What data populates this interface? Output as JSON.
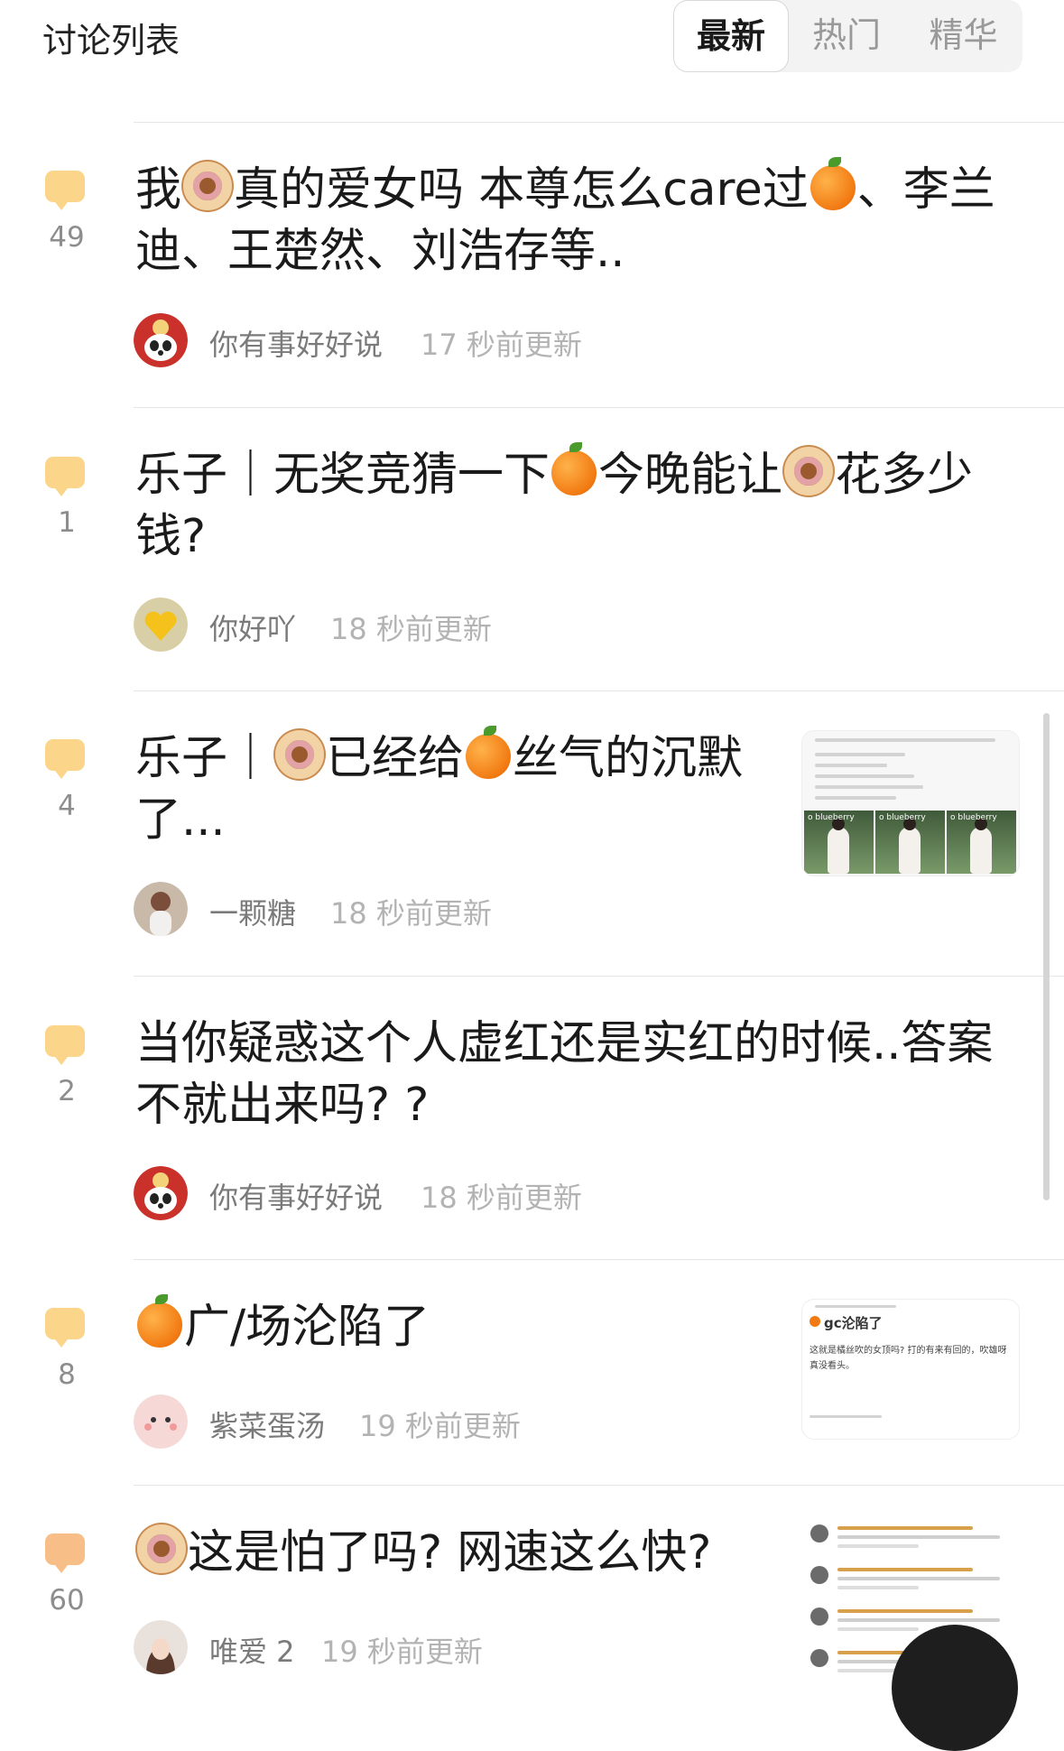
{
  "header": {
    "title": "讨论列表",
    "tabs": [
      {
        "label": "最新",
        "active": true
      },
      {
        "label": "热门",
        "active": false
      },
      {
        "label": "精华",
        "active": false
      }
    ]
  },
  "posts": [
    {
      "comment_count": "49",
      "title_parts": [
        "我",
        "真的爱女吗 本尊怎么care过",
        "、李兰迪、王楚然、刘浩存等.."
      ],
      "author": "你有事好好说",
      "time": "17 秒前更新"
    },
    {
      "comment_count": "1",
      "title_parts": [
        "乐子｜无奖竞猜一下",
        "今晚能让",
        "花多少钱?"
      ],
      "author": "你好吖",
      "time": "18 秒前更新"
    },
    {
      "comment_count": "4",
      "title_parts": [
        "乐子｜",
        "已经给",
        "丝气的沉默了..."
      ],
      "author": "一颗糖",
      "time": "18 秒前更新",
      "thumbnail": {
        "labels": [
          "o blueberry",
          "o blueberry",
          "o blueberry"
        ]
      }
    },
    {
      "comment_count": "2",
      "title": "当你疑惑这个人虚红还是实红的时候..答案不就出来吗? ?",
      "author": "你有事好好说",
      "time": "18 秒前更新"
    },
    {
      "comment_count": "8",
      "title_parts": [
        "广/场沦陷了"
      ],
      "author": "紫菜蛋汤",
      "time": "19 秒前更新",
      "thumbnail": {
        "caption": "gc沦陷了",
        "body": "这就是橘丝吹的女顶吗? 打的有来有回的，吹雄呀真没看头。"
      }
    },
    {
      "comment_count": "60",
      "title_parts": [
        "这是怕了吗? 网速这么快?"
      ],
      "author": "唯爱 2",
      "time": "19 秒前更新"
    }
  ],
  "icons": {
    "comment": "comment-bubble-icon",
    "donut": "donut-emoji",
    "orange": "tangerine-emoji"
  },
  "colors": {
    "comment_bubble": "#fbd68a",
    "comment_bubble_hot": "#f7bf87",
    "time_text": "#b3b3b3",
    "author_text": "#7a7a7a"
  }
}
